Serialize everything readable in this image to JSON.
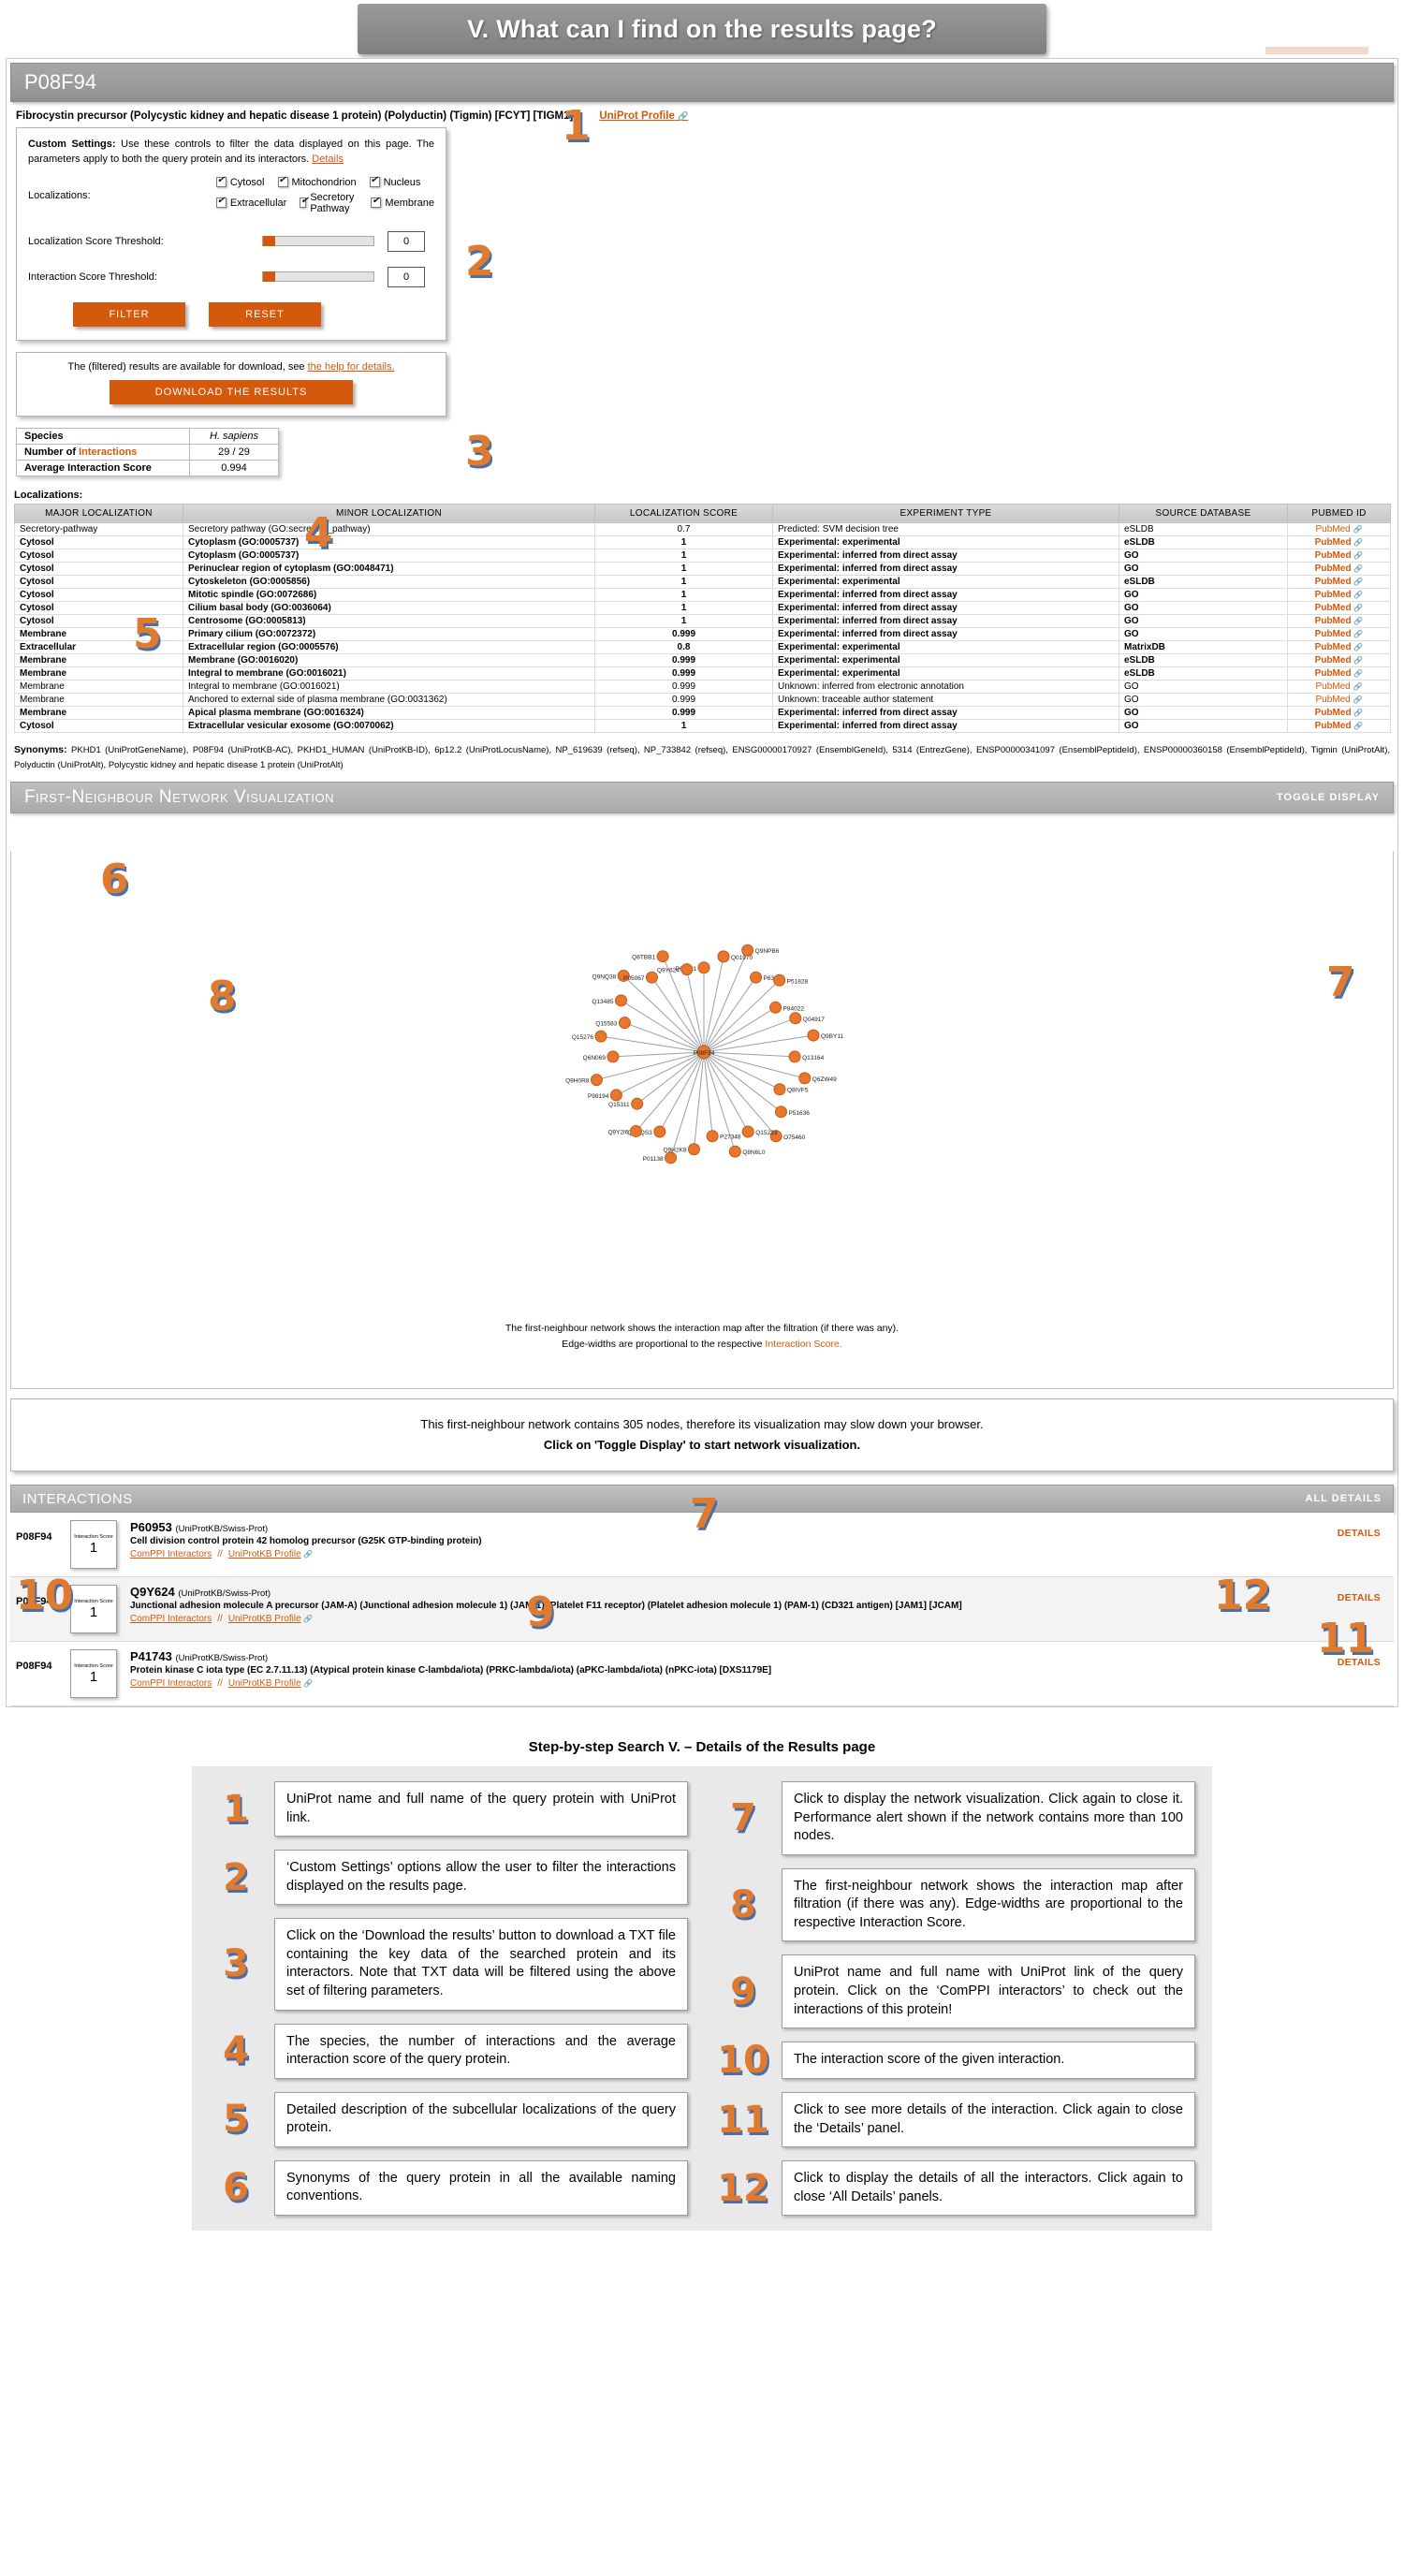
{
  "banner": {
    "title": "V. What can I find on the results page?"
  },
  "protein": {
    "accession": "P08F94",
    "full_name": "Fibrocystin precursor (Polycystic kidney and hepatic disease 1 protein) (Polyductin) (Tigmin) [FCYT] [TIGM1]",
    "uniprot_link": "UniProt Profile"
  },
  "settings": {
    "intro_bold": "Custom Settings:",
    "intro": " Use these controls to filter the data displayed on this page. The parameters apply to both the query protein and its interactors.",
    "details_link": "Details",
    "localizations_label": "Localizations:",
    "localizations": [
      "Cytosol",
      "Mitochondrion",
      "Nucleus",
      "Extracellular",
      "Secretory Pathway",
      "Membrane"
    ],
    "loc_score_label": "Localization Score Threshold:",
    "loc_score_value": "0",
    "int_score_label": "Interaction Score Threshold:",
    "int_score_value": "0",
    "filter_button": "FILTER",
    "reset_button": "RESET"
  },
  "download": {
    "text_prefix": "The (filtered) results are available for download, see ",
    "help_link": "the help for details.",
    "button": "DOWNLOAD THE RESULTS"
  },
  "species_table": {
    "rows": [
      {
        "key": "Species",
        "value": "H. sapiens",
        "italic": true
      },
      {
        "key": "Number of Interactions",
        "key_highlight": "Interactions",
        "value": "29 / 29",
        "italic": false
      },
      {
        "key": "Average Interaction Score",
        "value": "0.994",
        "italic": false
      }
    ]
  },
  "localizations": {
    "title": "Localizations:",
    "columns": [
      "MAJOR LOCALIZATION",
      "MINOR LOCALIZATION",
      "LOCALIZATION SCORE",
      "EXPERIMENT TYPE",
      "SOURCE DATABASE",
      "PUBMED ID"
    ],
    "rows": [
      {
        "major": "Secretory-pathway",
        "minor": "Secretory pathway (GO:secretory_pathway)",
        "score": "0.7",
        "experiment": "Predicted: SVM decision tree",
        "source": "eSLDB",
        "pubmed": "PubMed",
        "bold": false
      },
      {
        "major": "Cytosol",
        "minor": "Cytoplasm (GO:0005737)",
        "score": "1",
        "experiment": "Experimental: experimental",
        "source": "eSLDB",
        "pubmed": "PubMed",
        "bold": true
      },
      {
        "major": "Cytosol",
        "minor": "Cytoplasm (GO:0005737)",
        "score": "1",
        "experiment": "Experimental: inferred from direct assay",
        "source": "GO",
        "pubmed": "PubMed",
        "bold": true
      },
      {
        "major": "Cytosol",
        "minor": "Perinuclear region of cytoplasm (GO:0048471)",
        "score": "1",
        "experiment": "Experimental: inferred from direct assay",
        "source": "GO",
        "pubmed": "PubMed",
        "bold": true
      },
      {
        "major": "Cytosol",
        "minor": "Cytoskeleton (GO:0005856)",
        "score": "1",
        "experiment": "Experimental: experimental",
        "source": "eSLDB",
        "pubmed": "PubMed",
        "bold": true
      },
      {
        "major": "Cytosol",
        "minor": "Mitotic spindle (GO:0072686)",
        "score": "1",
        "experiment": "Experimental: inferred from direct assay",
        "source": "GO",
        "pubmed": "PubMed",
        "bold": true
      },
      {
        "major": "Cytosol",
        "minor": "Cilium basal body (GO:0036064)",
        "score": "1",
        "experiment": "Experimental: inferred from direct assay",
        "source": "GO",
        "pubmed": "PubMed",
        "bold": true
      },
      {
        "major": "Cytosol",
        "minor": "Centrosome (GO:0005813)",
        "score": "1",
        "experiment": "Experimental: inferred from direct assay",
        "source": "GO",
        "pubmed": "PubMed",
        "bold": true
      },
      {
        "major": "Membrane",
        "minor": "Primary cilium (GO:0072372)",
        "score": "0.999",
        "experiment": "Experimental: inferred from direct assay",
        "source": "GO",
        "pubmed": "PubMed",
        "bold": true
      },
      {
        "major": "Extracellular",
        "minor": "Extracellular region (GO:0005576)",
        "score": "0.8",
        "experiment": "Experimental: experimental",
        "source": "MatrixDB",
        "pubmed": "PubMed",
        "bold": true
      },
      {
        "major": "Membrane",
        "minor": "Membrane (GO:0016020)",
        "score": "0.999",
        "experiment": "Experimental: experimental",
        "source": "eSLDB",
        "pubmed": "PubMed",
        "bold": true
      },
      {
        "major": "Membrane",
        "minor": "Integral to membrane (GO:0016021)",
        "score": "0.999",
        "experiment": "Experimental: experimental",
        "source": "eSLDB",
        "pubmed": "PubMed",
        "bold": true
      },
      {
        "major": "Membrane",
        "minor": "Integral to membrane (GO:0016021)",
        "score": "0.999",
        "experiment": "Unknown: inferred from electronic annotation",
        "source": "GO",
        "pubmed": "PubMed",
        "bold": false
      },
      {
        "major": "Membrane",
        "minor": "Anchored to external side of plasma membrane (GO:0031362)",
        "score": "0.999",
        "experiment": "Unknown: traceable author statement",
        "source": "GO",
        "pubmed": "PubMed",
        "bold": false
      },
      {
        "major": "Membrane",
        "minor": "Apical plasma membrane (GO:0016324)",
        "score": "0.999",
        "experiment": "Experimental: inferred from direct assay",
        "source": "GO",
        "pubmed": "PubMed",
        "bold": true
      },
      {
        "major": "Cytosol",
        "minor": "Extracellular vesicular exosome (GO:0070062)",
        "score": "1",
        "experiment": "Experimental: inferred from direct assay",
        "source": "GO",
        "pubmed": "PubMed",
        "bold": true
      }
    ]
  },
  "synonyms": {
    "label": "Synonyms:",
    "text": "PKHD1 (UniProtGeneName), P08F94 (UniProtKB-AC), PKHD1_HUMAN (UniProtKB-ID), 6p12.2 (UniProtLocusName), NP_619639 (refseq), NP_733842 (refseq), ENSG00000170927 (EnsemblGeneId), 5314 (EntrezGene), ENSP00000341097 (EnsemblPeptideId), ENSP00000360158 (EnsemblPeptideId), Tigmin (UniProtAlt), Polyductin (UniProtAlt), Polycystic kidney and hepatic disease 1 protein (UniProtAlt)"
  },
  "network": {
    "title": "First-Neighbour Network Visualization",
    "toggle": "TOGGLE DISPLAY",
    "caption_line1": "The first-neighbour network shows the interaction map after the filtration (if there was any).",
    "caption_line2_prefix": "Edge-widths are proportional to the respective ",
    "caption_link": "Interaction Score.",
    "node_labels": [
      "P61981",
      "Q01970",
      "Q9NPB6",
      "P63167",
      "P51828",
      "P84022",
      "Q04917",
      "Q9BY11",
      "Q13164",
      "Q6ZW49",
      "Q8IVF5",
      "P51636",
      "O75460",
      "Q15233",
      "Q8N6L0",
      "P27348",
      "Q9H2K8",
      "P01138",
      "Q9NQS3",
      "Q9Y2I6",
      "Q15311",
      "P98194",
      "Q9H0R8",
      "Q6N069",
      "Q15276",
      "Q15583",
      "Q13485",
      "Q9NQ38",
      "P05067",
      "Q8TBB1",
      "Q9Y624",
      "P08F94"
    ]
  },
  "alert": {
    "line1": "This first-neighbour network contains 305 nodes, therefore its visualization may slow down your browser.",
    "line2": "Click on 'Toggle Display' to start network visualization."
  },
  "interactions": {
    "title": "INTERACTIONS",
    "all_details": "ALL DETAILS",
    "details_label": "DETAILS",
    "score_label": "Interaction Score",
    "comppi_link": "ComPPI Interactors",
    "separator": "//",
    "uniprot_link": "UniProtKB Profile",
    "rows": [
      {
        "query_ac": "P08F94",
        "score": "1",
        "id": "P60953",
        "id_source": "(UniProtKB/Swiss-Prot)",
        "desc": "Cell division control protein 42 homolog precursor (G25K GTP-binding protein)"
      },
      {
        "query_ac": "P08F94",
        "score": "1",
        "id": "Q9Y624",
        "id_source": "(UniProtKB/Swiss-Prot)",
        "desc": "Junctional adhesion molecule A precursor (JAM-A) (Junctional adhesion molecule 1) (JAM-1) (Platelet F11 receptor) (Platelet adhesion molecule 1) (PAM-1) (CD321 antigen) [JAM1] [JCAM]"
      },
      {
        "query_ac": "P08F94",
        "score": "1",
        "id": "P41743",
        "id_source": "(UniProtKB/Swiss-Prot)",
        "desc": "Protein kinase C iota type (EC 2.7.11.13) (Atypical protein kinase C-lambda/iota) (PRKC-lambda/iota) (aPKC-lambda/iota) (nPKC-iota) [DXS1179E]"
      }
    ]
  },
  "legend": {
    "title": "Step-by-step Search V. – Details of the Results page",
    "left": [
      {
        "num": "1",
        "text": "UniProt name and full name of the query protein with UniProt link."
      },
      {
        "num": "2",
        "text": "‘Custom Settings’ options allow the user to filter the interactions displayed on the results page."
      },
      {
        "num": "3",
        "text": "Click on the ‘Download the results’ button to download a TXT file containing the key data of the searched protein and its interactors. Note that TXT data will be filtered using the above set of filtering parameters."
      },
      {
        "num": "4",
        "text": "The species, the number of interactions and the average interaction score of the query protein."
      },
      {
        "num": "5",
        "text": "Detailed description of the subcellular localizations of the query protein."
      },
      {
        "num": "6",
        "text": "Synonyms of the query protein in all the available naming conventions."
      }
    ],
    "right": [
      {
        "num": "7",
        "text": "Click to display the network visualization. Click again to close it. Performance alert shown if the network contains more than 100 nodes."
      },
      {
        "num": "8",
        "text": "The first-neighbour network shows the interaction map after filtration (if there was any). Edge-widths are proportional to the respective Interaction Score."
      },
      {
        "num": "9",
        "text": "UniProt name and full name with UniProt link of the query protein. Click on the ‘ComPPI interactors’ to check out the interactions of this protein!"
      },
      {
        "num": "10",
        "text": "The interaction score of the given interaction."
      },
      {
        "num": "11",
        "text": "Click to see more details of the interaction. Click again to close the ‘Details’ panel."
      },
      {
        "num": "12",
        "text": "Click to display the details of all the interactors. Click again to close ‘All Details’ panels."
      }
    ]
  },
  "colors": {
    "accent": "#d4590c",
    "callout_orange": "#e07a2e",
    "callout_blue": "#4a6fa5"
  }
}
